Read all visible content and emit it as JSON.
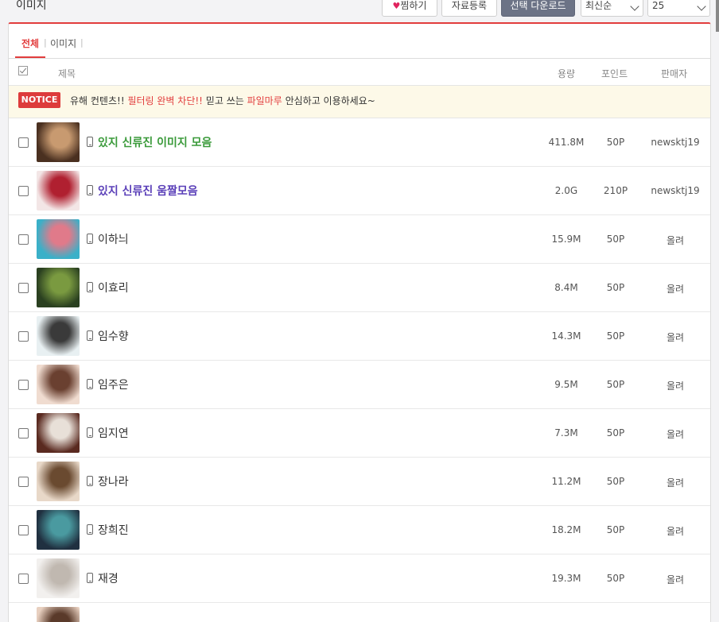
{
  "header": {
    "title": "이미지",
    "fav_label": "찜하기",
    "upload_label": "자료등록",
    "download_label": "선택 다운로드",
    "sort_value": "최신순",
    "count_value": "25"
  },
  "tabs": [
    {
      "label": "전체",
      "active": true
    },
    {
      "label": "이미지",
      "active": false
    }
  ],
  "table": {
    "columns": {
      "title": "제목",
      "size": "용량",
      "point": "포인트",
      "seller": "판매자"
    }
  },
  "notice": {
    "badge": "NOTICE",
    "parts": [
      {
        "text": "유해 컨텐츠!! ",
        "hl": false
      },
      {
        "text": "필터링 완벽 차단!!",
        "hl": true
      },
      {
        "text": " 믿고 쓰는 ",
        "hl": false
      },
      {
        "text": "파일마루",
        "hl": true
      },
      {
        "text": " 안심하고 이용하세요~",
        "hl": false
      }
    ]
  },
  "rows": [
    {
      "title": "있지 신류진 이미지 모음",
      "style": "green",
      "size": "411.8M",
      "point": "50P",
      "seller": "newsktj19",
      "thumb": [
        "#4a3020",
        "#c89a70"
      ]
    },
    {
      "title": "있지 신류진 움짤모음",
      "style": "purple",
      "size": "2.0G",
      "point": "210P",
      "seller": "newsktj19",
      "thumb": [
        "#f3e6e6",
        "#b02030"
      ]
    },
    {
      "title": "이하늬",
      "style": "",
      "size": "15.9M",
      "point": "50P",
      "seller": "올려",
      "thumb": [
        "#3ab0c8",
        "#e07a8a"
      ]
    },
    {
      "title": "이효리",
      "style": "",
      "size": "8.4M",
      "point": "50P",
      "seller": "올려",
      "thumb": [
        "#2a4020",
        "#7a9a40"
      ]
    },
    {
      "title": "임수향",
      "style": "",
      "size": "14.3M",
      "point": "50P",
      "seller": "올려",
      "thumb": [
        "#e8f0f2",
        "#3a3a3a"
      ]
    },
    {
      "title": "임주은",
      "style": "",
      "size": "9.5M",
      "point": "50P",
      "seller": "올려",
      "thumb": [
        "#f0dcd0",
        "#6a4030"
      ]
    },
    {
      "title": "임지연",
      "style": "",
      "size": "7.3M",
      "point": "50P",
      "seller": "올려",
      "thumb": [
        "#5a2a20",
        "#e8e0d8"
      ]
    },
    {
      "title": "장나라",
      "style": "",
      "size": "11.2M",
      "point": "50P",
      "seller": "올려",
      "thumb": [
        "#e8d8c8",
        "#6a4a30"
      ]
    },
    {
      "title": "장희진",
      "style": "",
      "size": "18.2M",
      "point": "50P",
      "seller": "올려",
      "thumb": [
        "#203040",
        "#4a9aa0"
      ]
    },
    {
      "title": "재경",
      "style": "",
      "size": "19.3M",
      "point": "50P",
      "seller": "올려",
      "thumb": [
        "#f2f0ee",
        "#c0b8b0"
      ]
    },
    {
      "title": "",
      "style": "",
      "size": "",
      "point": "",
      "seller": "",
      "thumb": [
        "#e8d0c0",
        "#5a3a2a"
      ]
    }
  ]
}
